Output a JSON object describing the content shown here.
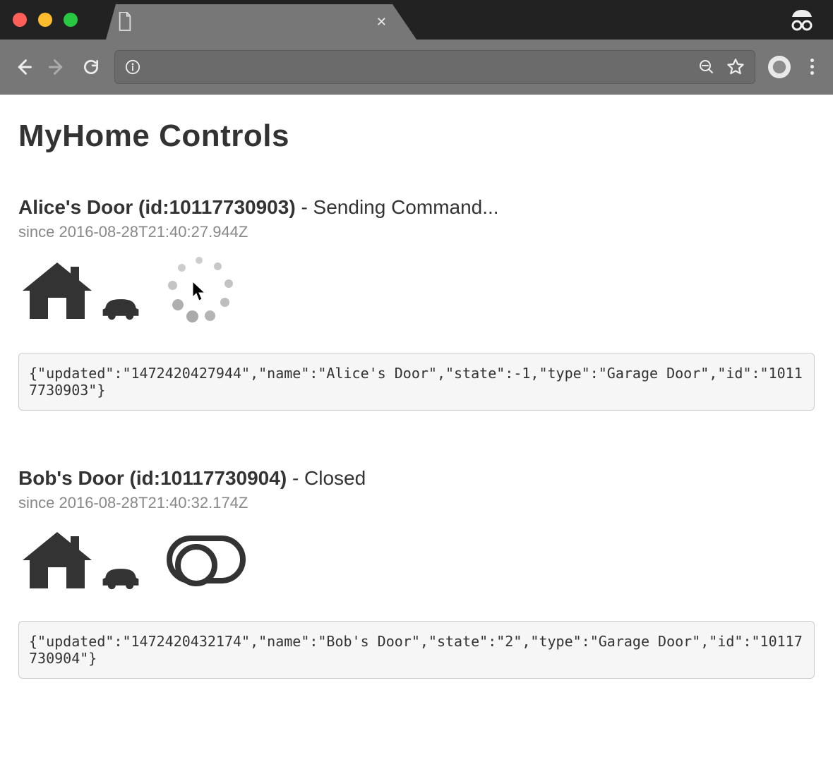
{
  "page": {
    "title": "MyHome Controls"
  },
  "devices": [
    {
      "name": "Alice's Door",
      "id": "10117730903",
      "status": "Sending Command...",
      "since_label": "since",
      "since": "2016-08-28T21:40:27.944Z",
      "loading": true,
      "json_display": "{\"updated\":\"1472420427944\",\"name\":\"Alice's Door\",\"state\":-1,\"type\":\"Garage Door\",\"id\":\"10117730903\"}"
    },
    {
      "name": "Bob's Door",
      "id": "10117730904",
      "status": "Closed",
      "since_label": "since",
      "since": "2016-08-28T21:40:32.174Z",
      "loading": false,
      "json_display": "{\"updated\":\"1472420432174\",\"name\":\"Bob's Door\",\"state\":\"2\",\"type\":\"Garage Door\",\"id\":\"10117730904\"}"
    }
  ]
}
